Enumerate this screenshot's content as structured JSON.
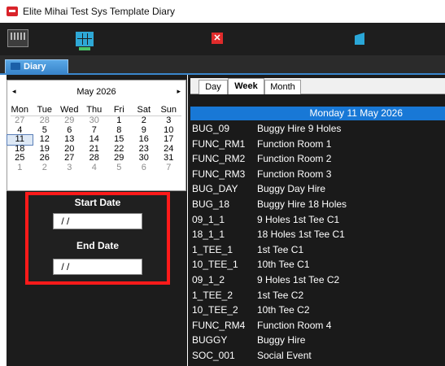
{
  "window": {
    "title": "Elite Mihai Test Sys Template Diary"
  },
  "toolbar": {
    "buttons": [
      {
        "icon": "monitor-icon"
      },
      {
        "icon": "grid-icon"
      },
      {
        "icon": "close-icon",
        "glyph": "✕"
      },
      {
        "icon": "door-exit-icon"
      }
    ]
  },
  "tabs": {
    "diary": "Diary"
  },
  "calendar": {
    "prev": "◂",
    "next": "▸",
    "month_label": "May 2026",
    "days_of_week": [
      "Mon",
      "Tue",
      "Wed",
      "Thu",
      "Fri",
      "Sat",
      "Sun"
    ],
    "selected_day": "11",
    "weeks": [
      [
        "27",
        "28",
        "29",
        "30",
        "1",
        "2",
        "3"
      ],
      [
        "4",
        "5",
        "6",
        "7",
        "8",
        "9",
        "10"
      ],
      [
        "11",
        "12",
        "13",
        "14",
        "15",
        "16",
        "17"
      ],
      [
        "18",
        "19",
        "20",
        "21",
        "22",
        "23",
        "24"
      ],
      [
        "25",
        "26",
        "27",
        "28",
        "29",
        "30",
        "31"
      ],
      [
        "1",
        "2",
        "3",
        "4",
        "5",
        "6",
        "7"
      ]
    ]
  },
  "date_range": {
    "start_label": "Start Date",
    "start_value": " / /",
    "end_label": "End Date",
    "end_value": " / /"
  },
  "view_tabs": [
    "Day",
    "Week",
    "Month"
  ],
  "active_view": "Week",
  "schedule": {
    "date_header": "Monday 11 May 2026",
    "resources": [
      {
        "code": "BUG_09",
        "name": "Buggy Hire 9 Holes"
      },
      {
        "code": "FUNC_RM1",
        "name": "Function Room 1"
      },
      {
        "code": "FUNC_RM2",
        "name": "Function Room 2"
      },
      {
        "code": "FUNC_RM3",
        "name": "Function Room 3"
      },
      {
        "code": "BUG_DAY",
        "name": "Buggy Day Hire"
      },
      {
        "code": "BUG_18",
        "name": "Buggy Hire 18 Holes"
      },
      {
        "code": "09_1_1",
        "name": "9 Holes 1st Tee C1"
      },
      {
        "code": "18_1_1",
        "name": "18 Holes 1st Tee C1"
      },
      {
        "code": "1_TEE_1",
        "name": "1st Tee C1"
      },
      {
        "code": "10_TEE_1",
        "name": "10th Tee C1"
      },
      {
        "code": "09_1_2",
        "name": "9 Holes 1st Tee C2"
      },
      {
        "code": "1_TEE_2",
        "name": "1st Tee C2"
      },
      {
        "code": "10_TEE_2",
        "name": "10th Tee C2"
      },
      {
        "code": "FUNC_RM4",
        "name": "Function Room 4"
      },
      {
        "code": "BUGGY",
        "name": "Buggy Hire"
      },
      {
        "code": "SOC_001",
        "name": "Social Event"
      }
    ]
  }
}
